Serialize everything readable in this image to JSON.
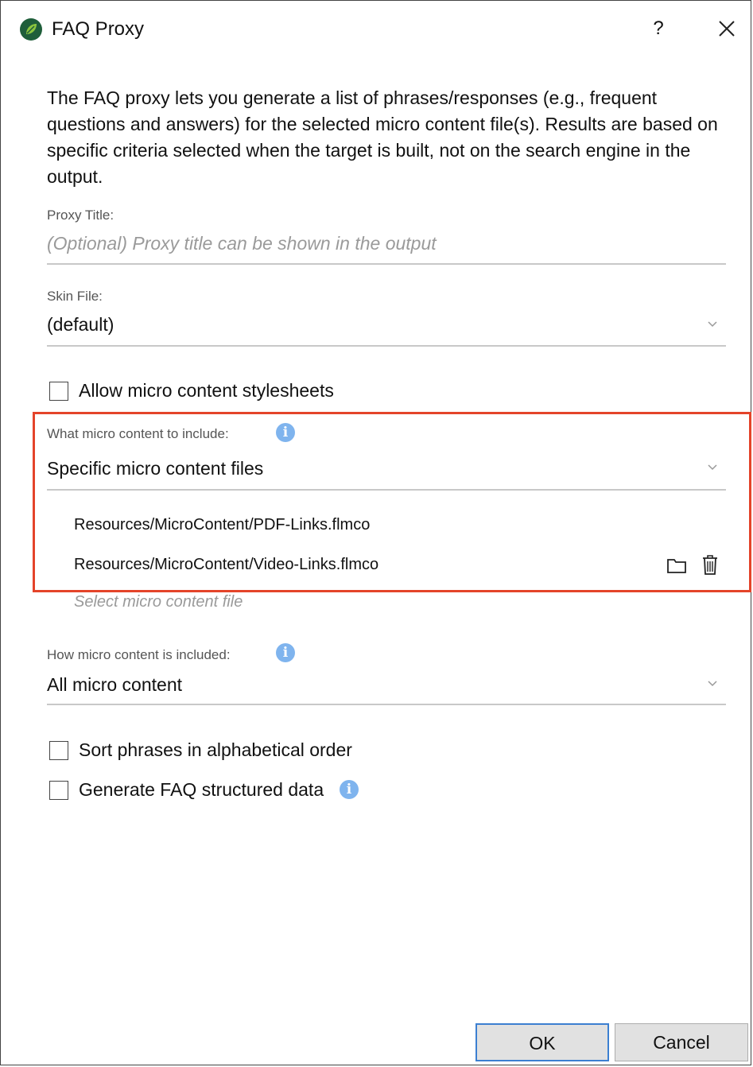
{
  "window": {
    "title": "FAQ Proxy",
    "help_label": "?",
    "app_icon": "madcap-flare-leaf-icon",
    "close_icon": "close-icon"
  },
  "description": "The FAQ proxy lets you generate a list of phrases/responses (e.g., frequent questions and answers) for the selected micro content file(s). Results are based on specific criteria selected when the target is built, not on the search engine in the output.",
  "proxy_title": {
    "label": "Proxy Title:",
    "placeholder": "(Optional) Proxy title can be shown in the output",
    "value": ""
  },
  "skin_file": {
    "label": "Skin File:",
    "selected": "(default)"
  },
  "allow_stylesheets": {
    "label": "Allow micro content stylesheets",
    "checked": false
  },
  "what_to_include": {
    "label": "What micro content to include:",
    "selected": "Specific micro content files",
    "files": [
      "Resources/MicroContent/PDF-Links.flmco",
      "Resources/MicroContent/Video-Links.flmco"
    ],
    "add_file_placeholder": "Select micro content file"
  },
  "how_included": {
    "label": "How micro content is included:",
    "selected": "All micro content"
  },
  "sort_alphabetical": {
    "label": "Sort phrases in alphabetical order",
    "checked": false
  },
  "generate_structured": {
    "label": "Generate FAQ structured data",
    "checked": false
  },
  "buttons": {
    "ok": "OK",
    "cancel": "Cancel"
  },
  "colors": {
    "highlight": "#e4442a",
    "info": "#7fb4ee",
    "ok_border": "#3c7fd1"
  }
}
